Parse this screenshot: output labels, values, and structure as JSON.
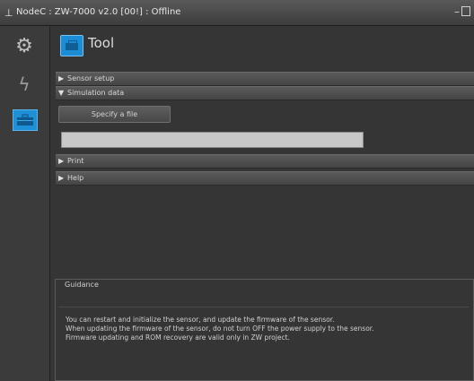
{
  "window": {
    "title": "NodeC : ZW-7000 v2.0 [00!] : Offline",
    "minimize_glyph": "–"
  },
  "rail": {
    "items": [
      {
        "name": "settings",
        "icon": "gear-icon"
      },
      {
        "name": "power",
        "icon": "lightning-icon"
      },
      {
        "name": "tool",
        "icon": "toolbox-icon",
        "active": true
      }
    ]
  },
  "header": {
    "title": "Tool",
    "icon": "toolbox-icon"
  },
  "sections": {
    "sensor_setup": {
      "label": "Sensor setup",
      "expanded": false
    },
    "simulation_data": {
      "label": "Simulation data",
      "expanded": true
    },
    "print": {
      "label": "Print",
      "expanded": false
    },
    "help": {
      "label": "Help",
      "expanded": false
    }
  },
  "simulation": {
    "specify_button": "Specify a file"
  },
  "guidance": {
    "title": "Guidance",
    "lines": [
      "You can restart and initialize the sensor, and update the firmware of the sensor.",
      "When updating the firmware of the sensor, do not turn OFF the power supply to the sensor.",
      "Firmware updating and ROM recovery are valid only in ZW project."
    ]
  },
  "colors": {
    "accent": "#1f8fd6",
    "background": "#353535"
  }
}
